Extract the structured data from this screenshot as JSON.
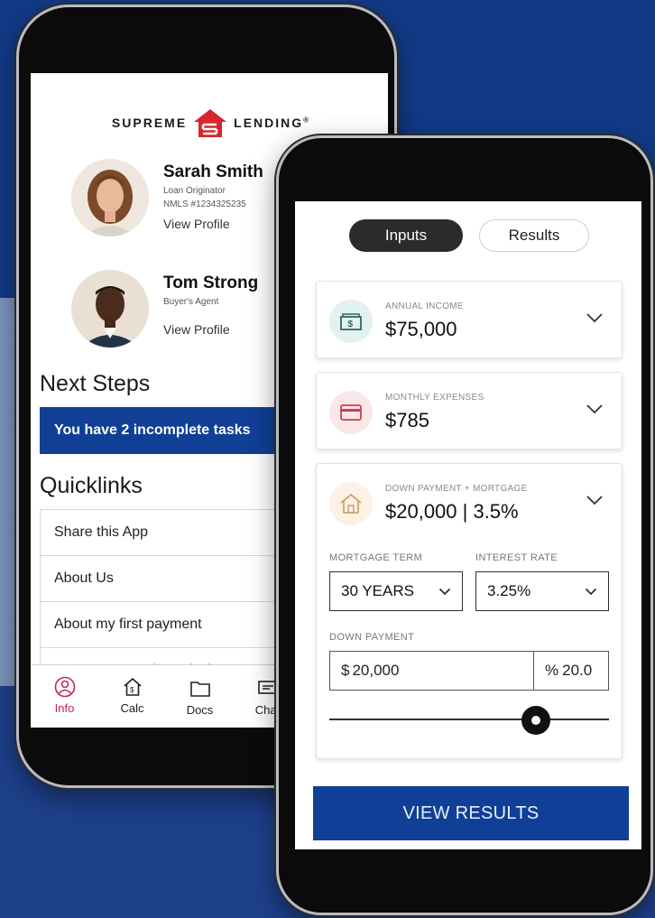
{
  "brand": {
    "name_left": "SUPREME",
    "name_right": "LENDING",
    "trademark": "®"
  },
  "contacts": [
    {
      "name": "Sarah Smith",
      "role": "Loan Originator",
      "nmls": "NMLS #1234325235",
      "link": "View Profile"
    },
    {
      "name": "Tom Strong",
      "role": "Buyer's Agent",
      "link": "View Profile"
    }
  ],
  "next_steps": {
    "heading": "Next Steps",
    "banner": "You have 2 incomplete tasks"
  },
  "quicklinks": {
    "heading": "Quicklinks",
    "items": [
      "Share this App",
      "About Us",
      "About my first payment",
      "Mortgage Coach Analysis"
    ]
  },
  "tabbar": {
    "items": [
      {
        "label": "Info",
        "icon": "profile-icon",
        "active": true
      },
      {
        "label": "Calc",
        "icon": "home-dollar-icon",
        "active": false
      },
      {
        "label": "Docs",
        "icon": "folder-icon",
        "active": false
      },
      {
        "label": "Chat",
        "icon": "chat-icon",
        "active": false
      }
    ]
  },
  "calculator": {
    "tabs": {
      "inputs": "Inputs",
      "results": "Results"
    },
    "annual_income": {
      "label": "ANNUAL INCOME",
      "value": "$75,000",
      "icon": "cash-icon"
    },
    "monthly_expenses": {
      "label": "MONTHLY EXPENSES",
      "value": "$785",
      "icon": "credit-card-icon"
    },
    "down_payment_mortgage": {
      "label": "DOWN PAYMENT + MORTGAGE",
      "value": "$20,000 | 3.5%",
      "icon": "house-icon",
      "mortgage_term_label": "MORTGAGE TERM",
      "mortgage_term_value": "30 YEARS",
      "interest_rate_label": "INTEREST RATE",
      "interest_rate_value": "3.25%",
      "down_payment_label": "DOWN PAYMENT",
      "down_payment_currency": "$",
      "down_payment_amount": "20,000",
      "down_payment_percent_symbol": "%",
      "down_payment_percent": "20.0",
      "slider_position": 0.74
    },
    "cta": "VIEW RESULTS"
  },
  "colors": {
    "brand_blue": "#113f96",
    "brand_red": "#d7262e",
    "active_tab": "#c3264a",
    "income_icon_bg": "#e3f1ef",
    "expense_icon_bg": "#fbe7e8",
    "house_icon_bg": "#fbf1e4"
  }
}
